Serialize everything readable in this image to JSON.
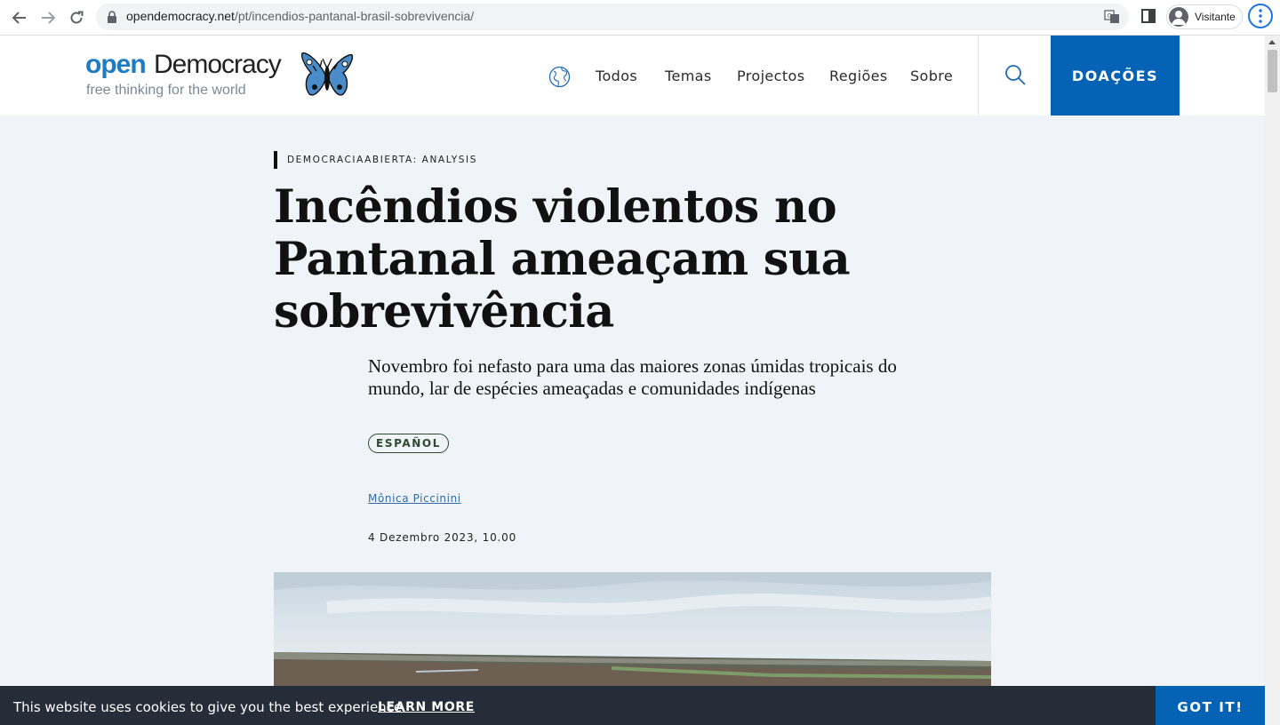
{
  "browser": {
    "url_host": "opendemocracy.net",
    "url_path": "/pt/incendios-pantanal-brasil-sobrevivencia/",
    "profile_label": "Visitante"
  },
  "site": {
    "logo_open": "open",
    "logo_democracy": "Democracy",
    "tagline": "free thinking for the world",
    "nav": [
      "Todos",
      "Temas",
      "Projectos",
      "Regiões",
      "Sobre"
    ],
    "donate_label": "DOAÇÕES",
    "accent_color": "#0562b5"
  },
  "article": {
    "kicker": "DEMOCRACIAABIERTA: ANALYSIS",
    "title": "Incêndios violentos no Pantanal ameaçam sua sobrevivência",
    "subtitle": "Novembro foi nefasto para uma das maiores zonas úmidas tropicais do mundo, lar de espécies ameaçadas e comunidades indígenas",
    "language_tag": "ESPAÑOL",
    "author": "Mônica Piccinini",
    "date": "4 Dezembro 2023, 10.00"
  },
  "cookie_banner": {
    "message": "This website uses cookies to give you the best experience.",
    "learn_more": "LEARN MORE",
    "accept": "GOT IT!"
  }
}
